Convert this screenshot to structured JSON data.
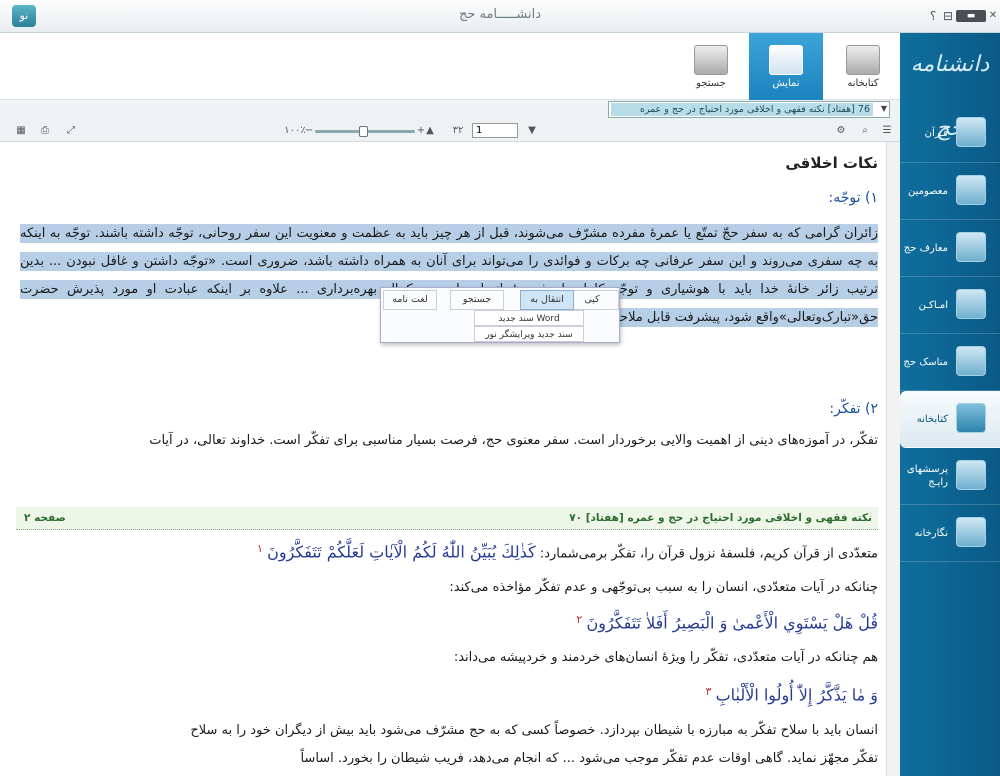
{
  "window": {
    "title": "دانشـــــامه حج",
    "help": "؟",
    "restore": "⊟",
    "minimize": "▬",
    "close": "✕",
    "logo": "نو"
  },
  "sidebar": {
    "logo": "دانشنامه حج",
    "items": [
      {
        "label": "قـرآن"
      },
      {
        "label": "معصومین"
      },
      {
        "label": "معارف حج"
      },
      {
        "label": "امـاکـن"
      },
      {
        "label": "مناسک حج"
      },
      {
        "label": "کتابخانه"
      },
      {
        "label": "پرسشهای رایـج"
      },
      {
        "label": "نگارخانه"
      }
    ]
  },
  "ribbon": {
    "tabs": [
      {
        "label": "کتابخانه"
      },
      {
        "label": "نمایش"
      },
      {
        "label": "جستجو"
      }
    ]
  },
  "addr": {
    "tab_num": "76",
    "tab_text": "[هفتاد] نکته فقهی و اخلاقی مورد احتیاج در حج و عمره",
    "close": "×"
  },
  "toolbar": {
    "zoom": "۱۰۰٪",
    "page_current": "1",
    "page_total": "۳۲",
    "minus": "−",
    "plus": "+"
  },
  "doc": {
    "heading": "نکات اخلاقی",
    "s1": "۱) توجّه:",
    "p1": "زائران گرامی که به سفر حجّ تمتّع یا عمرۀ مفرده مشرّف می‌شوند، قبل از هر چیز باید به عظمت و معنویت این سفر روحانی، توجّه داشته باشند. توجّه به اینکه به چه سفری می‌روند و این سفر عرفانی چه برکات و فوائدی را می‌تواند برای آنان به همراه داشته باشد، ضروری است. «توجّه داشتن و غافل نبودن ... بدین ترتیب زائر خانۀ خدا باید با هوشیاری و توجّه کامل، از فریضۀ انسان‌ساز حج، کمال بهره‌برداری ... علاوه بر اینکه عبادت او مورد پذیرش حضرت حق«تبارک‌وتعالی»واقع شود، پیشرفت قابل ملاحظه‌ای نیز در سیر و سلوک داشته باشد.",
    "s2": "۲) تفکّر:",
    "p2": "تفکّر، در آموزه‌های دینی از اهمیت والایی برخوردار است. سفر معنوی حج، فرصت بسیار مناسبی برای تفکّر است. خداوند تعالی، در آیات",
    "footer_title": "۷۰ [هفتاد] نکته فقهی و اخلاقی مورد احتیاج در حج و عمره",
    "footer_page": "صفحه ۲",
    "l1": "متعدّدی از قرآن کریم، فلسفۀ نزول قرآن را، تفکّر برمی‌شمارد:",
    "a1": "كَذٰلِكَ يُبَيِّنُ اللّٰهُ لَكُمُ الْآيٰاتِ لَعَلَّكُمْ تَتَفَكَّرُونَ",
    "n1": "۱",
    "l2": "چنانکه در آیات متعدّدی، انسان را به سبب بی‌توجّهی و عدم تفکّر مؤاخذه می‌کند:",
    "a2": "قُلْ هَلْ يَسْتَوِي الْأَعْمىٰ وَ الْبَصِيرُ أَفَلاٰ تَتَفَكَّرُونَ",
    "n2": "۲",
    "l3": "هم چنانکه در آیات متعدّدی، تفکّر را ویژۀ انسان‌های خردمند و خردپیشه می‌داند:",
    "a3": "وَ مٰا يَذَّكَّرُ إِلاّٰ أُولُوا الْأَلْبٰابِ",
    "n3": "۳",
    "l4": "انسان باید با سلاح تفکّر به مبارزه با شیطان بپردازد. خصوصاً کسی که به حج مشرّف می‌شود باید بیش از دیگران خود را به سلاح",
    "l5": "تفکّر مجهّز نماید. گاهی اوقات عدم تفکّر موجب می‌شود ... که انجام می‌دهد، فریب شیطان را بخورد. اساساً"
  },
  "popup": {
    "items": [
      "کپی",
      "انتقال به",
      "جستجو",
      "لغت نامه"
    ],
    "sub": [
      "سند جدید Word",
      "سند جدید ویرایشگر نور"
    ]
  }
}
